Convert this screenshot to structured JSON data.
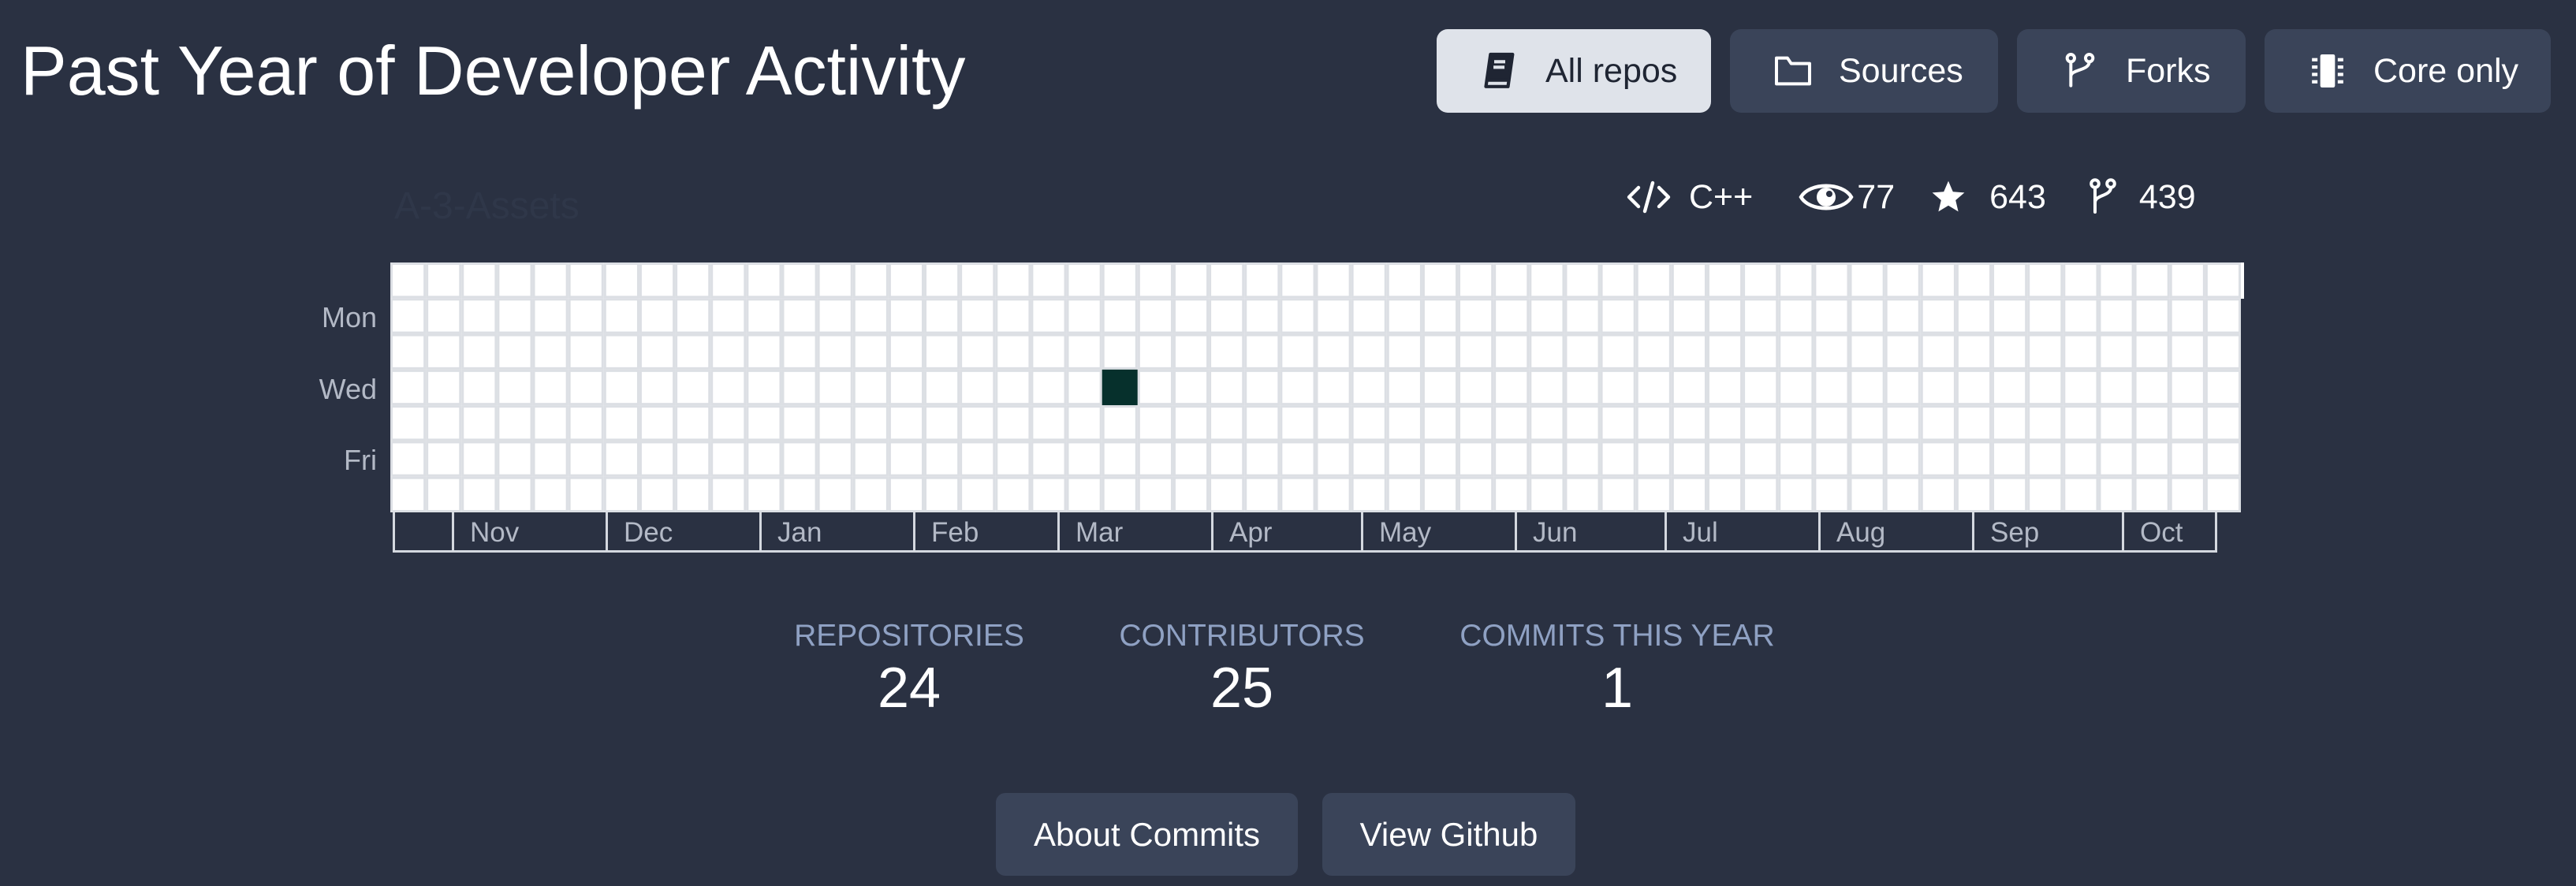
{
  "header": {
    "title": "Past Year of Developer Activity"
  },
  "filters": [
    {
      "label": "All repos",
      "icon": "book-icon",
      "active": true
    },
    {
      "label": "Sources",
      "icon": "folder-icon",
      "active": false
    },
    {
      "label": "Forks",
      "icon": "fork-icon",
      "active": false
    },
    {
      "label": "Core only",
      "icon": "chip-icon",
      "active": false
    }
  ],
  "repo": {
    "name": "A-3-Assets",
    "language": "C++",
    "watchers": "77",
    "stars": "643",
    "forks": "439"
  },
  "heatmap": {
    "days": [
      "Mon",
      "Wed",
      "Fri"
    ],
    "months": [
      "Nov",
      "Dec",
      "Jan",
      "Feb",
      "Mar",
      "Apr",
      "May",
      "Jun",
      "Jul",
      "Aug",
      "Sep",
      "Oct"
    ],
    "weeks": 52,
    "active_cells": [
      {
        "week": 20,
        "day": 3,
        "count": 1
      }
    ],
    "active_color": "#06302c",
    "empty_color": "#ffffff",
    "grid_color": "#dcdfe4"
  },
  "summary": {
    "repositories_label": "REPOSITORIES",
    "repositories_value": "24",
    "contributors_label": "CONTRIBUTORS",
    "contributors_value": "25",
    "commits_label": "COMMITS THIS YEAR",
    "commits_value": "1"
  },
  "actions": {
    "about_commits": "About Commits",
    "view_github": "View Github"
  },
  "colors": {
    "background": "#2a3142",
    "button": "#3a4459",
    "button_active": "#dfe3ea",
    "label_blue": "#8fa1c3"
  }
}
